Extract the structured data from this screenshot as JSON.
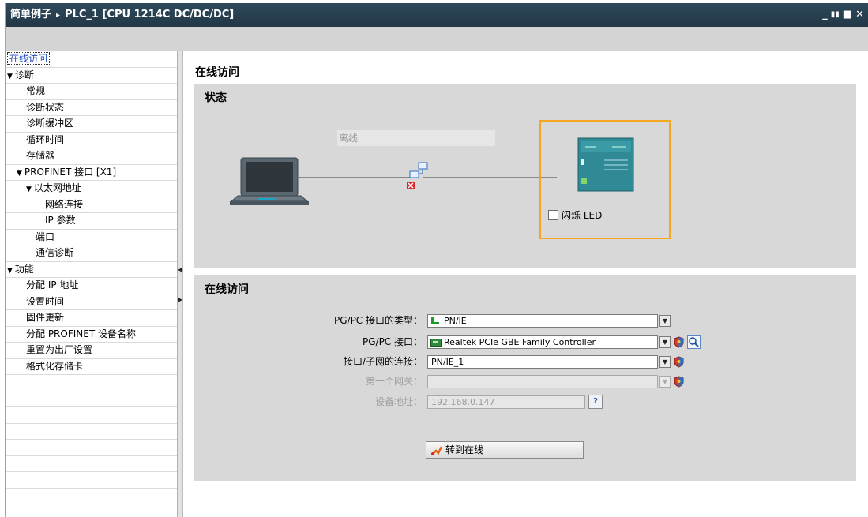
{
  "window": {
    "title_project": "简单例子",
    "title_sep": "▸",
    "title_device": "PLC_1 [CPU 1214C DC/DC/DC]",
    "controls": [
      "_",
      "▮▮",
      "■",
      "✕"
    ]
  },
  "sidebar": {
    "items": [
      {
        "label": "在线访问",
        "indent": 0,
        "arrow": "",
        "selected": true
      },
      {
        "label": "诊断",
        "indent": 0,
        "arrow": "▼",
        "selected": false
      },
      {
        "label": "常规",
        "indent": 2,
        "arrow": "",
        "selected": false
      },
      {
        "label": "诊断状态",
        "indent": 2,
        "arrow": "",
        "selected": false
      },
      {
        "label": "诊断缓冲区",
        "indent": 2,
        "arrow": "",
        "selected": false
      },
      {
        "label": "循环时间",
        "indent": 2,
        "arrow": "",
        "selected": false
      },
      {
        "label": "存储器",
        "indent": 2,
        "arrow": "",
        "selected": false
      },
      {
        "label": "PROFINET 接口 [X1]",
        "indent": 1,
        "arrow": "▼",
        "selected": false
      },
      {
        "label": "以太网地址",
        "indent": 2,
        "arrow": "▼",
        "selected": false
      },
      {
        "label": "网络连接",
        "indent": 4,
        "arrow": "",
        "selected": false
      },
      {
        "label": "IP 参数",
        "indent": 4,
        "arrow": "",
        "selected": false
      },
      {
        "label": "端口",
        "indent": 3,
        "arrow": "",
        "selected": false
      },
      {
        "label": "通信诊断",
        "indent": 3,
        "arrow": "",
        "selected": false
      },
      {
        "label": "功能",
        "indent": 0,
        "arrow": "▼",
        "selected": false
      },
      {
        "label": "分配 IP 地址",
        "indent": 2,
        "arrow": "",
        "selected": false
      },
      {
        "label": "设置时间",
        "indent": 2,
        "arrow": "",
        "selected": false
      },
      {
        "label": "固件更新",
        "indent": 2,
        "arrow": "",
        "selected": false
      },
      {
        "label": "分配 PROFINET 设备名称",
        "indent": 2,
        "arrow": "",
        "selected": false
      },
      {
        "label": "重置为出厂设置",
        "indent": 2,
        "arrow": "",
        "selected": false
      },
      {
        "label": "格式化存储卡",
        "indent": 2,
        "arrow": "",
        "selected": false
      },
      {
        "label": "",
        "indent": 0,
        "arrow": "",
        "selected": false
      },
      {
        "label": "",
        "indent": 0,
        "arrow": "",
        "selected": false
      },
      {
        "label": "",
        "indent": 0,
        "arrow": "",
        "selected": false
      },
      {
        "label": "",
        "indent": 0,
        "arrow": "",
        "selected": false
      },
      {
        "label": "",
        "indent": 0,
        "arrow": "",
        "selected": false
      },
      {
        "label": "",
        "indent": 0,
        "arrow": "",
        "selected": false
      },
      {
        "label": "",
        "indent": 0,
        "arrow": "",
        "selected": false
      },
      {
        "label": "",
        "indent": 0,
        "arrow": "",
        "selected": false
      }
    ]
  },
  "main": {
    "section_title": "在线访问",
    "status_panel": {
      "title": "状态",
      "status_text": "离线",
      "led_checkbox_label": "闪烁 LED",
      "led_checked": false
    },
    "online_panel": {
      "title": "在线访问",
      "pgpc_type_label": "PG/PC 接口的类型：",
      "pgpc_type_value": "PN/IE",
      "pgpc_iface_label": "PG/PC 接口：",
      "pgpc_iface_value": "Realtek PCIe GBE Family Controller",
      "subnet_label": "接口/子网的连接：",
      "subnet_value": "PN/IE_1",
      "gateway_label": "第一个网关：",
      "gateway_value": "",
      "address_label": "设备地址：",
      "address_value": "192.168.0.147",
      "go_online_button": "转到在线"
    }
  },
  "colors": {
    "titlebar": "#2a4252",
    "highlight_frame": "#f5a623",
    "panel_bg": "#d8d8d8",
    "selected_text": "#1f4fbf"
  }
}
